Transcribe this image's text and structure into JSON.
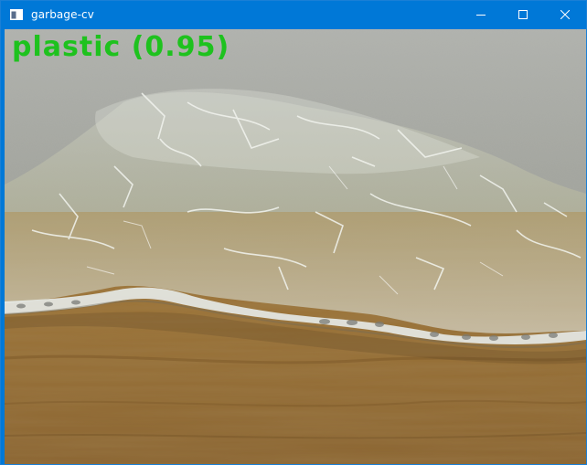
{
  "window": {
    "title": "garbage-cv",
    "controls": [
      "minimize",
      "maximize",
      "close"
    ]
  },
  "icons": {
    "app": "app-window-icon",
    "minimize": "minimize-icon",
    "maximize": "maximize-icon",
    "close": "close-icon"
  },
  "colors": {
    "titlebar": "#0078d7",
    "label": "#1ec21e"
  },
  "detection": {
    "label_text": "plastic (0.95)",
    "class": "plastic",
    "confidence": 0.95
  }
}
